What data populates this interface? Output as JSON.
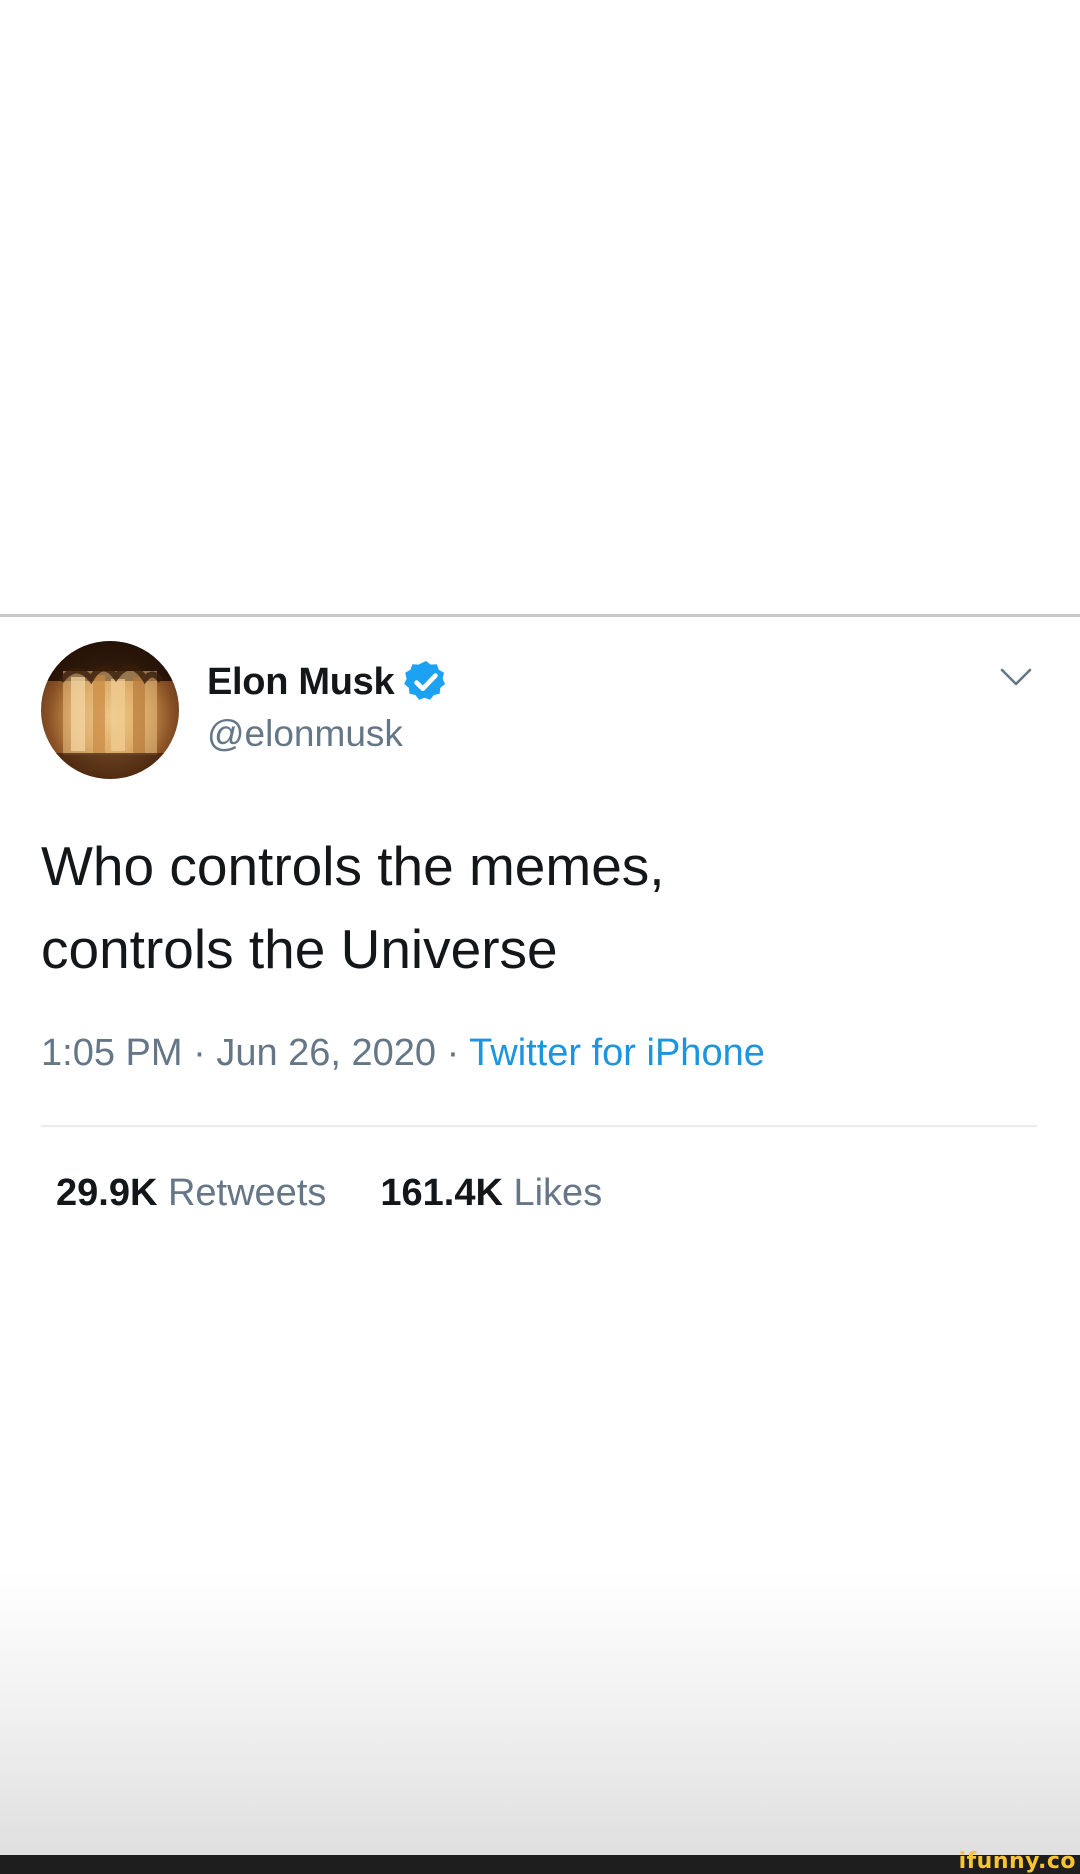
{
  "tweet": {
    "author": {
      "display_name": "Elon Musk",
      "handle": "@elonmusk",
      "verified": true,
      "avatar_icon": "avatar-image"
    },
    "menu_icon": "chevron-down-icon",
    "text_lines": [
      "Who controls the memes,",
      "controls the Universe"
    ],
    "time": "1:05 PM",
    "separator": "·",
    "date": "Jun 26, 2020",
    "source": "Twitter for iPhone",
    "stats": {
      "retweets_count": "29.9K",
      "retweets_label": "Retweets",
      "likes_count": "161.4K",
      "likes_label": "Likes"
    }
  },
  "watermark": "ifunny.co",
  "colors": {
    "text_primary": "#14171a",
    "text_secondary": "#657786",
    "link_blue": "#1b95e0",
    "verified_blue": "#1da1f2",
    "watermark_yellow": "#f6c531"
  }
}
